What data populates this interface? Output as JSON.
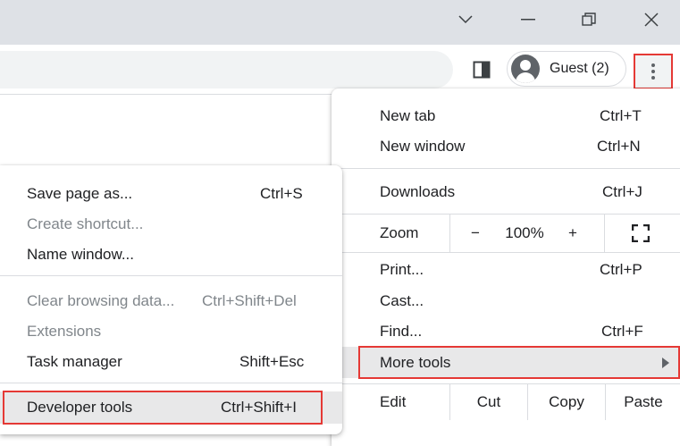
{
  "window_controls": {
    "dropdown_icon": "chevron-down-icon",
    "minimize_icon": "minimize-icon",
    "restore_icon": "restore-icon",
    "close_icon": "close-icon"
  },
  "toolbar": {
    "profile_label": "Guest (2)",
    "menu_icon": "three-dot-menu-icon"
  },
  "main_menu": {
    "new_tab": {
      "label": "New tab",
      "shortcut": "Ctrl+T"
    },
    "new_window": {
      "label": "New window",
      "shortcut": "Ctrl+N"
    },
    "downloads": {
      "label": "Downloads",
      "shortcut": "Ctrl+J"
    },
    "zoom": {
      "label": "Zoom",
      "minus": "−",
      "value": "100%",
      "plus": "+"
    },
    "print": {
      "label": "Print...",
      "shortcut": "Ctrl+P"
    },
    "cast": {
      "label": "Cast..."
    },
    "find": {
      "label": "Find...",
      "shortcut": "Ctrl+F"
    },
    "more_tools": {
      "label": "More tools"
    },
    "edit": {
      "label": "Edit",
      "cut": "Cut",
      "copy": "Copy",
      "paste": "Paste"
    }
  },
  "more_tools_menu": {
    "save_page": {
      "label": "Save page as...",
      "shortcut": "Ctrl+S"
    },
    "create_shortcut": {
      "label": "Create shortcut..."
    },
    "name_window": {
      "label": "Name window..."
    },
    "clear_browsing": {
      "label": "Clear browsing data...",
      "shortcut": "Ctrl+Shift+Del"
    },
    "extensions": {
      "label": "Extensions"
    },
    "task_manager": {
      "label": "Task manager",
      "shortcut": "Shift+Esc"
    },
    "developer_tools": {
      "label": "Developer tools",
      "shortcut": "Ctrl+Shift+I"
    }
  },
  "colors": {
    "highlight_border": "#e53935",
    "titlebar": "#dee1e6",
    "menu_hover": "#e8e8e9"
  }
}
